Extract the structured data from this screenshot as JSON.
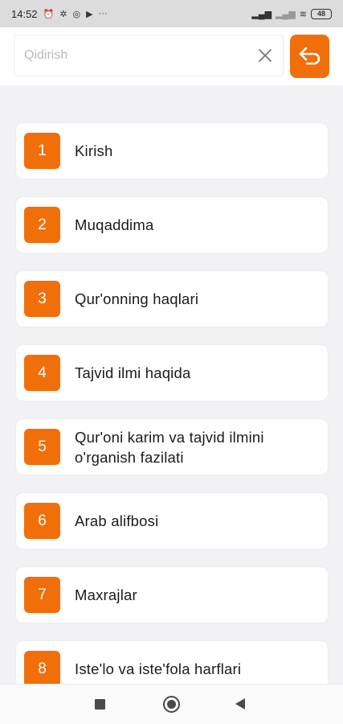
{
  "status_bar": {
    "time": "14:52",
    "dots": "···",
    "battery": "48"
  },
  "search": {
    "placeholder": "Qidirish",
    "value": ""
  },
  "topics": [
    {
      "number": "1",
      "title": "Kirish"
    },
    {
      "number": "2",
      "title": "Muqaddima"
    },
    {
      "number": "3",
      "title": "Qur'onning haqlari"
    },
    {
      "number": "4",
      "title": "Tajvid ilmi haqida"
    },
    {
      "number": "5",
      "title": "Qur'oni karim va tajvid ilmini o'rganish fazilati"
    },
    {
      "number": "6",
      "title": "Arab alifbosi"
    },
    {
      "number": "7",
      "title": "Maxrajlar"
    },
    {
      "number": "8",
      "title": "Iste'lo va iste'fola harflari"
    }
  ],
  "colors": {
    "accent": "#f06f0a",
    "background": "#f2f2f4",
    "card": "#ffffff"
  },
  "icons": {
    "clear": "close-icon",
    "back": "return-arrow-icon"
  }
}
